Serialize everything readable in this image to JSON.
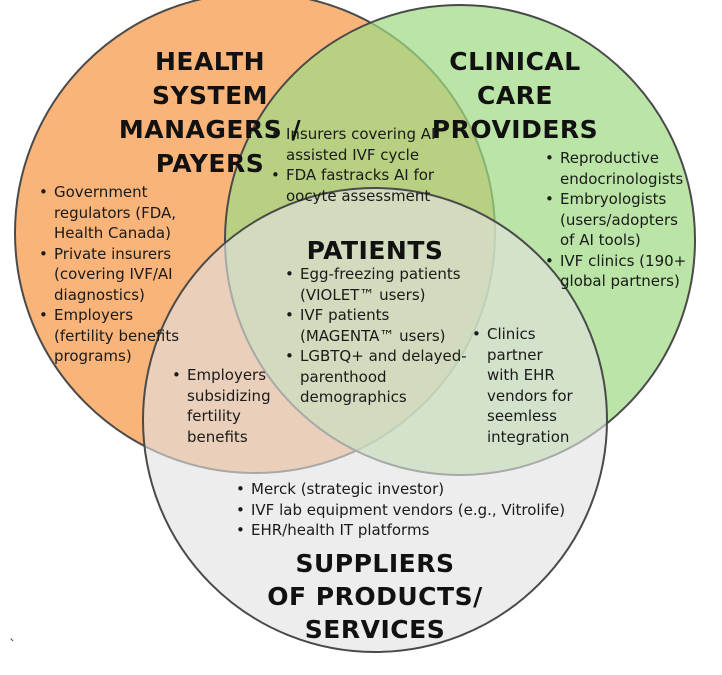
{
  "colors": {
    "health_system": "#f7a35c",
    "clinical_care": "#9fdb84",
    "suppliers": "#e2e2e2",
    "outline": "#4a4a4a"
  },
  "titles": {
    "health_system": "HEALTH\nSYSTEM\nMANAGERS /\nPAYERS",
    "clinical_care": "CLINICAL\nCARE\nPROVIDERS",
    "patients": "PATIENTS",
    "suppliers": "SUPPLIERS\nOF PRODUCTS/\nSERVICES"
  },
  "lists": {
    "health_system": [
      "Government\nregulators (FDA,\nHealth Canada)",
      "Private insurers\n(covering IVF/AI\ndiagnostics)",
      "Employers\n(fertility benefits\nprograms)"
    ],
    "health_clinical_overlap": [
      "Insurers covering AI\nassisted IVF cycle",
      "FDA fastracks AI for\noocyte assessment"
    ],
    "clinical_care": [
      "Reproductive\nendocrinologists",
      "Embryologists\n(users/adopters\nof AI tools)",
      "IVF clinics (190+\nglobal partners)"
    ],
    "patients": [
      "Egg-freezing patients\n(VIOLET™ users)",
      "IVF patients\n(MAGENTA™ users)",
      "LGBTQ+ and delayed-\nparenthood\ndemographics"
    ],
    "health_suppliers_overlap": [
      "Employers\nsubsidizing\nfertility\nbenefits"
    ],
    "clinical_suppliers_overlap": [
      "Clinics\npartner\nwith EHR\nvendors for\nseemless\nintegration"
    ],
    "suppliers": [
      "Merck (strategic investor)",
      "IVF lab equipment vendors (e.g., Vitrolife)",
      "EHR/health IT platforms"
    ]
  },
  "stray_mark": "`"
}
